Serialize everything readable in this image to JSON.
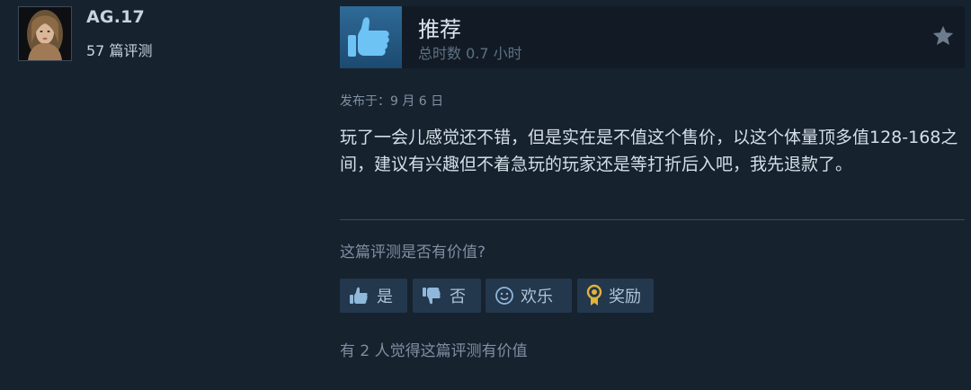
{
  "author": {
    "username": "AG.17",
    "review_count": "57 篇评测"
  },
  "header": {
    "verdict": "推荐",
    "hours": "总时数 0.7 小时",
    "icons": [
      "thumbs-up-icon",
      "star-icon"
    ]
  },
  "review": {
    "posted": "发布于：9 月 6 日",
    "text": "玩了一会儿感觉还不错，但是实在是不值这个售价，以这个体量顶多值128-168之间，建议有兴趣但不着急玩的玩家还是等打折后入吧，我先退款了。"
  },
  "feedback": {
    "question": "这篇评测是否有价值?",
    "yes_label": "是",
    "no_label": "否",
    "funny_label": "欢乐",
    "award_label": "奖励",
    "helpful_count": "有 2 人觉得这篇评测有价值"
  },
  "colors": {
    "background": "#17222f",
    "button": "#23374d",
    "thumb_box": "#2f6a97",
    "award_gold": "#e0b33a"
  }
}
